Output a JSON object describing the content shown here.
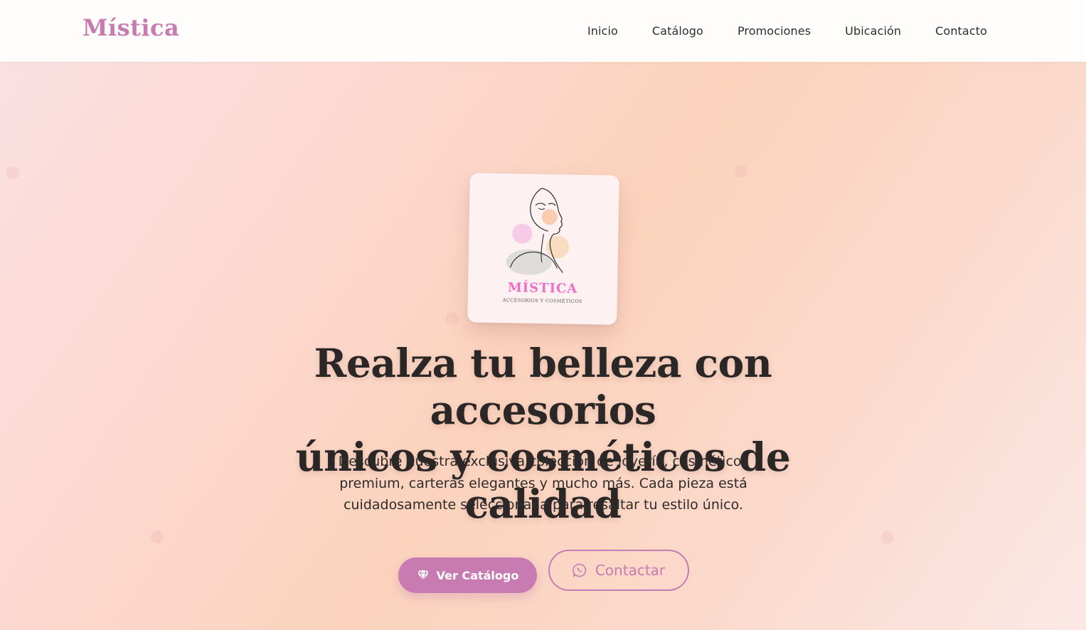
{
  "brand": {
    "name": "Mística"
  },
  "nav": {
    "items": [
      {
        "label": "Inicio"
      },
      {
        "label": "Catálogo"
      },
      {
        "label": "Promociones"
      },
      {
        "label": "Ubicación"
      },
      {
        "label": "Contacto"
      }
    ]
  },
  "hero": {
    "logo": {
      "title": "MÍSTICA",
      "subtitle": "ACCESORIOS Y COSMÉTICOS",
      "icon": "woman-face-line-art"
    },
    "headline_line1": "Realza tu belleza con accesorios",
    "headline_line2": "únicos y cosméticos de calidad",
    "description": "Descubre nuestra exclusiva colección de joyería, cosméticos premium, carteras elegantes y mucho más. Cada pieza está cuidadosamente seleccionada para resaltar tu estilo único.",
    "primary_button": {
      "label": "Ver Catálogo",
      "icon": "gem-icon"
    },
    "secondary_button": {
      "label": "Contactar",
      "icon": "whatsapp-icon"
    }
  },
  "colors": {
    "accent": "#c77bb0",
    "logo_pink": "#f06fc6",
    "text_dark": "#2c2727"
  }
}
